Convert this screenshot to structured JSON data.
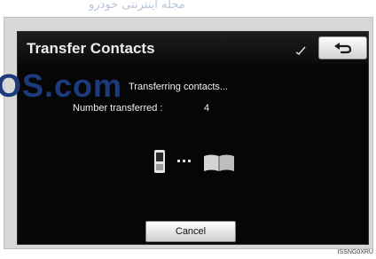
{
  "watermark": {
    "top_text": "مجله اینترنتی خودرو",
    "site_text": "OS.com"
  },
  "screen": {
    "title": "Transfer Contacts",
    "back_icon": "return-arrow-icon",
    "status_text": "Transferring contacts...",
    "count_label": "Number transferred :",
    "count_value": "4",
    "cancel_label": "Cancel"
  },
  "figure_code": "ISSNG0XRU"
}
